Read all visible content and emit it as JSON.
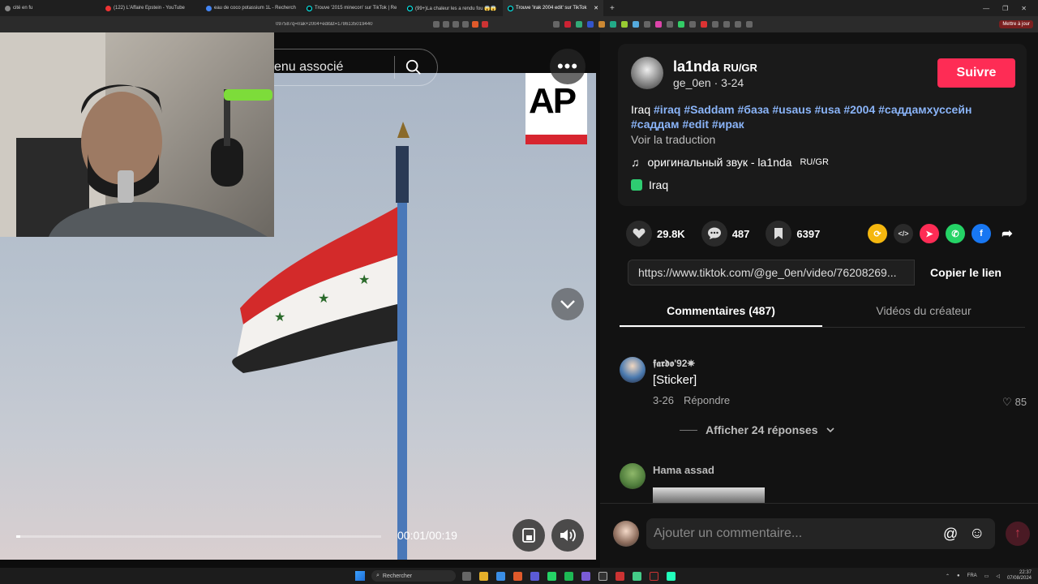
{
  "browser": {
    "tabs": [
      {
        "label": "cité en fu"
      },
      {
        "label": "(122) L'Affaire Epstein - YouTube"
      },
      {
        "label": "eau de coco potassium 1L - Recherch"
      },
      {
        "label": "Trouve '2015 minecon' sur TikTok | Re"
      },
      {
        "label": "(99+)La chaleur les a rendu fou 😱😱"
      },
      {
        "label": "Trouve 'Irak 2004 edit' sur TikTok"
      }
    ],
    "url": "097587q=Irak+2004+edit&t=1786135019440",
    "extension_button": "Mettre à jour"
  },
  "video": {
    "search_placeholder": "enu associé",
    "more_label": "•••",
    "watermark": "AP",
    "time": "00:01/00:19",
    "progress_percent": 1
  },
  "post": {
    "author": "la1nda",
    "author_suffix": "RU/GR",
    "handle": "ge_0en · 3-24",
    "follow_label": "Suivre",
    "caption_prefix": "Iraq",
    "hashtags": [
      "#iraq",
      "#Saddam",
      "#база",
      "#usaus",
      "#usa",
      "#2004",
      "#саддамхуссейн",
      "#саддам",
      "#edit",
      "#ирак"
    ],
    "translate": "Voir la traduction",
    "sound": "оригинальный звук - la1nda",
    "sound_suffix": "RU/GR",
    "location": "Iraq"
  },
  "actions": {
    "likes": "29.8K",
    "comments": "487",
    "saves": "6397"
  },
  "share_link": {
    "url": "https://www.tiktok.com/@ge_0en/video/76208269...",
    "copy_label": "Copier le lien"
  },
  "tabs": {
    "comments": "Commentaires (487)",
    "creator_videos": "Vidéos du créateur"
  },
  "comments": [
    {
      "name": "𝖋𝖆𝖗𝖉𝖔'92✵",
      "text": "[Sticker]",
      "date": "3-26",
      "reply": "Répondre",
      "likes": "85",
      "replies": "Afficher 24 réponses"
    },
    {
      "name": "Hama assad"
    }
  ],
  "compose": {
    "placeholder": "Ajouter un commentaire..."
  },
  "taskbar": {
    "search": "Rechercher",
    "lang": "FRA",
    "time": "22:37",
    "date": "07/08/2024"
  }
}
